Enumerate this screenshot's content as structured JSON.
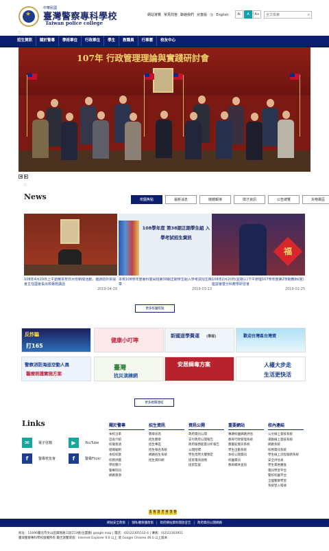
{
  "header": {
    "emblem_label": "",
    "org_small": "中華民國",
    "org_zh": "臺灣警察專科學校",
    "org_en": "Taiwan police college",
    "top_links": [
      "網站導覽",
      "常見問答",
      "聯絡我們",
      "兒童版"
    ],
    "language": "English",
    "font_sizes": [
      "A-",
      "A",
      "A+"
    ],
    "search_placeholder": "全文檢索",
    "mark": "□"
  },
  "nav": [
    "招生資訊",
    "關於警專",
    "學術單位",
    "行政單位",
    "學生",
    "教職員",
    "行事曆",
    "校友中心"
  ],
  "banner": {
    "title": "107年 行政管理理論與實踐研討會",
    "dots": [
      "◀",
      "▶"
    ],
    "mark": "□"
  },
  "news": {
    "heading": "News",
    "tabs": [
      "校園焦點",
      "最新消息",
      "媒體報導",
      "徵才資訊",
      "公告總覽",
      "失物專區"
    ],
    "active_tab": "校園焦點",
    "cards": [
      {
        "title": "108年4月29日上午劉耀本校日月份新聞活動，邀請前外貿協會主任國會長出校專題講話",
        "date": "2019-04-29",
        "img_text": ""
      },
      {
        "title": "本校108學年度專科警員班第38期正期學生組入學考試招生簡章",
        "date": "2019-03-13",
        "img_text": "108學年度 第38期正期學生組 入學考試招生資訊"
      },
      {
        "title": "108年2月20日(星期三)下午辦理107學年度第2學期教師(官)座談會暨分科教學研習會",
        "date": "2019-02-25",
        "img_text": "福"
      }
    ],
    "more": "更多校園焦點"
  },
  "ads": [
    {
      "text": "反詐騙",
      "sub": "打165"
    },
    {
      "text": "健康小叮嚀",
      "sub": ""
    },
    {
      "text": "新國道學費運",
      "sub": "(舉報)"
    },
    {
      "text": "歡迎台灣區台灣資",
      "sub": ""
    },
    {
      "text": "警察消防海巡空勤人員",
      "sub": "醫療照護實施方案"
    },
    {
      "text": "臺灣",
      "sub": "抗災演練網"
    },
    {
      "text": "安居緝毒方案",
      "sub": ""
    },
    {
      "text": "人權大步走",
      "sub": "生活更快活"
    }
  ],
  "ads_more": "更多相關連結",
  "links": {
    "heading": "Links",
    "social": [
      {
        "icon": "mail-icon",
        "label": "電子信箱",
        "color": "#1aa59b",
        "glyph": "✉"
      },
      {
        "icon": "youtube-icon",
        "label": "YouTube",
        "color": "#1aa59b",
        "glyph": "▶"
      },
      {
        "icon": "facebook-icon",
        "label": "警專校友會",
        "color": "#1d3e8f",
        "glyph": "f"
      },
      {
        "icon": "flickr-icon",
        "label": "警專Flickr",
        "color": "#1d3e8f",
        "glyph": "f"
      }
    ],
    "columns": [
      {
        "title": "關於警專",
        "items": [
          "本校沿革",
          "首長介紹",
          "校徽意涵",
          "組織編制",
          "本校校歌",
          "校務評鑑",
          "學校簡介",
          "警專院訊",
          "網路資源"
        ]
      },
      {
        "title": "招生資訊",
        "items": [
          "簡章訊息",
          "招生簡章",
          "招生專區",
          "招生報名系統",
          "網路招生系統",
          "招生資料網"
        ]
      },
      {
        "title": "資訊公開",
        "items": [
          "政府資訊公開",
          "支付政府公開報告",
          "政府服務能量分析報告",
          "公開招標",
          "學生借用大樓預定",
          "提昇電效說明",
          "提昇監督"
        ]
      },
      {
        "title": "重要網站",
        "items": [
          "專題校園網路評估",
          "教育行政管理系統",
          "圖書館資訊系統",
          "學生出勤系統",
          "本校公開資訊",
          "校園資訊",
          "教師補休查詢"
        ]
      },
      {
        "title": "校內連結",
        "items": [
          "公文線上簽核系統",
          "運動線上簽核系統",
          "網路系統",
          "校務資訊系統",
          "學生線上流程服務系統",
          "安全評估表",
          "學生資格審查",
          "電訊學習平台",
          "警校校園平台",
          "全國警察學習",
          "系統登入帳號"
        ]
      }
    ]
  },
  "counter": [
    "1",
    "6",
    "3",
    "7",
    "4",
    "3",
    "0"
  ],
  "footer_links": [
    "網站安全政策",
    "隱私權保護政策",
    "政府網站資料開放宣告",
    "政府資訊公開網路"
  ],
  "footer_info": [
    "校址：11696臺北市文山區興隆路三段153號(位置圖) google map | 電話：(02)22305512-4 | 傳真：(02)22303951",
    "臺灣警察專科學校版權所有 最佳瀏覽環境：Internet Explorer 9.0 以上 或 Google Chrome 46.0 以上版本"
  ]
}
